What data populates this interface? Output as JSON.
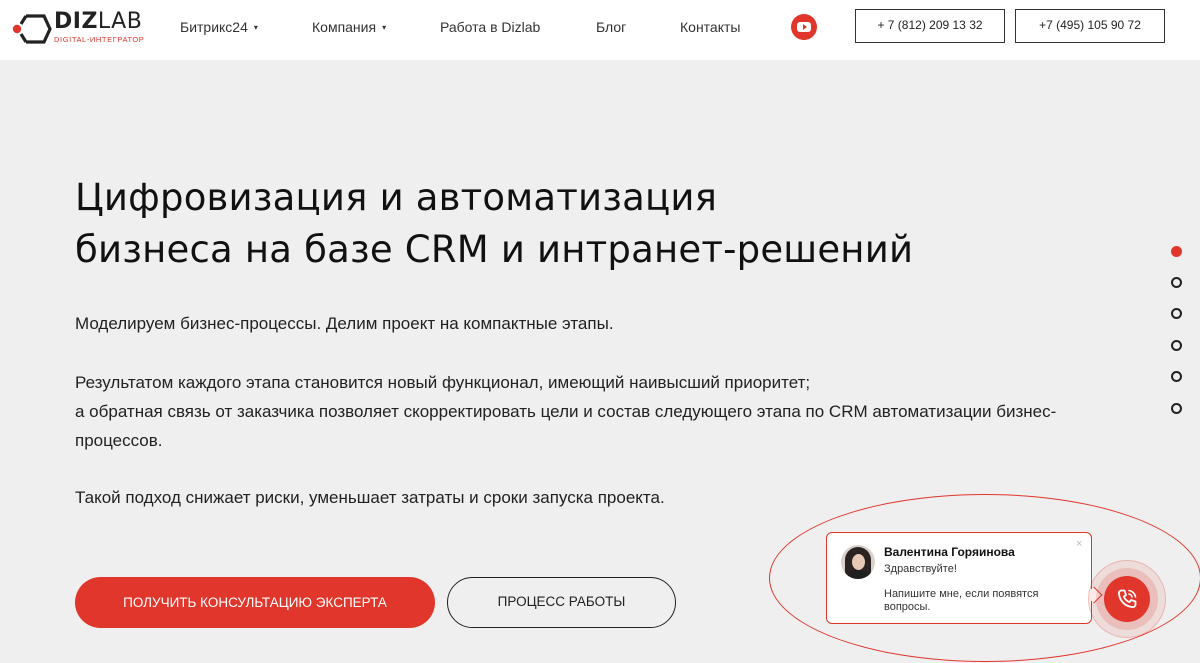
{
  "brand": {
    "name_bold": "DIZ",
    "name_thin": "LAB",
    "tagline": "DIGITAL-ИНТЕГРАТОР",
    "accent": "#e0362c"
  },
  "nav": {
    "items": [
      {
        "label": "Битрикс24",
        "has_dropdown": true
      },
      {
        "label": "Компания",
        "has_dropdown": true
      },
      {
        "label": "Работа в Dizlab",
        "has_dropdown": false
      },
      {
        "label": "Блог",
        "has_dropdown": false
      },
      {
        "label": "Контакты",
        "has_dropdown": false
      }
    ],
    "caret": "▾",
    "youtube_icon": "youtube-icon"
  },
  "phones": [
    "+ 7 (812) 209 13 32",
    "+7 (495) 105 90 72"
  ],
  "hero": {
    "title_line1": "Цифровизация и автоматизация",
    "title_line2": "бизнеса на базе CRM и интранет-решений",
    "p1": "Моделируем бизнес-процессы. Делим проект на компактные этапы.",
    "p2_line1": "Результатом каждого этапа становится новый функционал, имеющий наивысший приоритет;",
    "p2_line2": "а обратная связь от заказчика позволяет скорректировать цели и состав следующего этапа по CRM автоматизации бизнес-процессов.",
    "p3": "Такой подход снижает риски, уменьшает затраты и сроки запуска проекта.",
    "cta_primary": "ПОЛУЧИТЬ КОНСУЛЬТАЦИЮ ЭКСПЕРТА",
    "cta_secondary": "ПРОЦЕСС РАБОТЫ"
  },
  "pagination": {
    "total": 6,
    "active_index": 0
  },
  "chat": {
    "name": "Валентина Горяинова",
    "greeting": "Здравствуйте!",
    "message": "Напишите мне, если появятся вопросы.",
    "close": "×",
    "call_icon": "phone-call-icon"
  }
}
